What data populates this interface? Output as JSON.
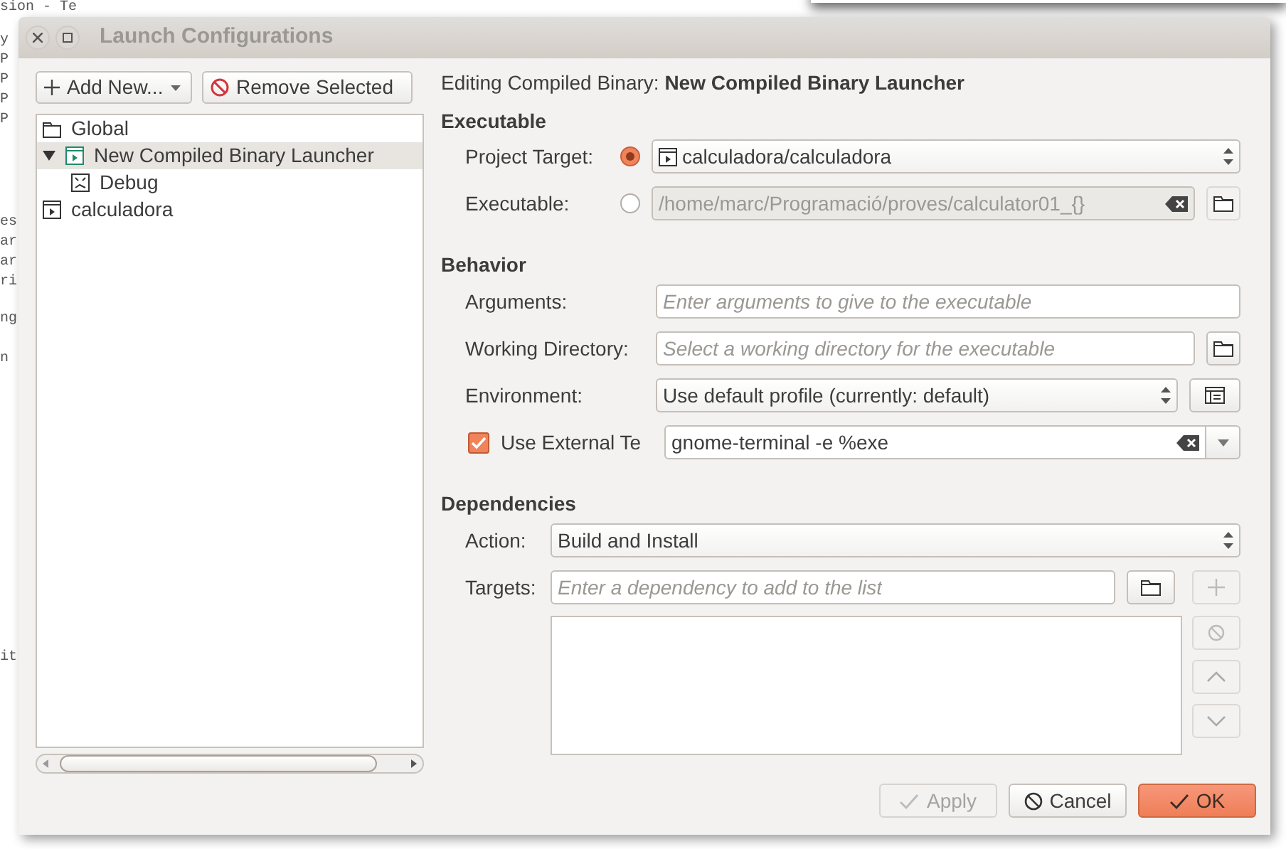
{
  "background_editor": {
    "line_groups": [
      [
        "sion - Te"
      ],
      [
        "y",
        "P",
        "P",
        "P",
        "P"
      ],
      [
        "es",
        "ar",
        "ar",
        "ri"
      ],
      [
        "ng"
      ],
      [
        "n"
      ],
      [
        "it"
      ]
    ]
  },
  "window": {
    "title": "Launch Configurations"
  },
  "toolbar": {
    "add_button": "Add New...",
    "remove_button": "Remove Selected"
  },
  "tree": [
    {
      "label": "Global",
      "kind": "folder",
      "selected": false
    },
    {
      "label": "New Compiled Binary Launcher",
      "kind": "launcher",
      "selected": true,
      "expanded": true,
      "children": [
        {
          "label": "Debug",
          "kind": "mode",
          "selected": false
        }
      ]
    },
    {
      "label": "calculadora",
      "kind": "target",
      "selected": false
    }
  ],
  "heading": "Editing Compiled Binary: **New Compiled Binary Launcher**",
  "executable_section": {
    "title": "Executable",
    "project_target": {
      "label": "Project Target:",
      "selected": true,
      "value": "calculadora/calculadora"
    },
    "executable": {
      "label": "Executable:",
      "selected": false,
      "value": "/home/marc/Programació/proves/calculator01_{}"
    }
  },
  "behavior_section": {
    "title": "Behavior",
    "arguments": {
      "label": "Arguments:",
      "placeholder": "Enter arguments to give to the executable"
    },
    "working_directory": {
      "label": "Working Directory:",
      "placeholder": "Select a working directory for the executable"
    },
    "environment": {
      "label": "Environment:",
      "value": "Use default profile (currently: default)"
    },
    "external_terminal": {
      "label": "Use External Te",
      "checked": true,
      "value": "gnome-terminal -e %exe"
    }
  },
  "dependencies_section": {
    "title": "Dependencies",
    "action": {
      "label": "Action:",
      "value": "Build and Install"
    },
    "targets": {
      "label": "Targets:",
      "placeholder": "Enter a dependency to add to the list"
    }
  },
  "buttons": [
    {
      "label": "Apply",
      "kind": "apply",
      "disabled": true
    },
    {
      "label": "Cancel",
      "kind": "cancel",
      "disabled": false
    },
    {
      "label": "OK",
      "kind": "ok",
      "disabled": false
    }
  ]
}
